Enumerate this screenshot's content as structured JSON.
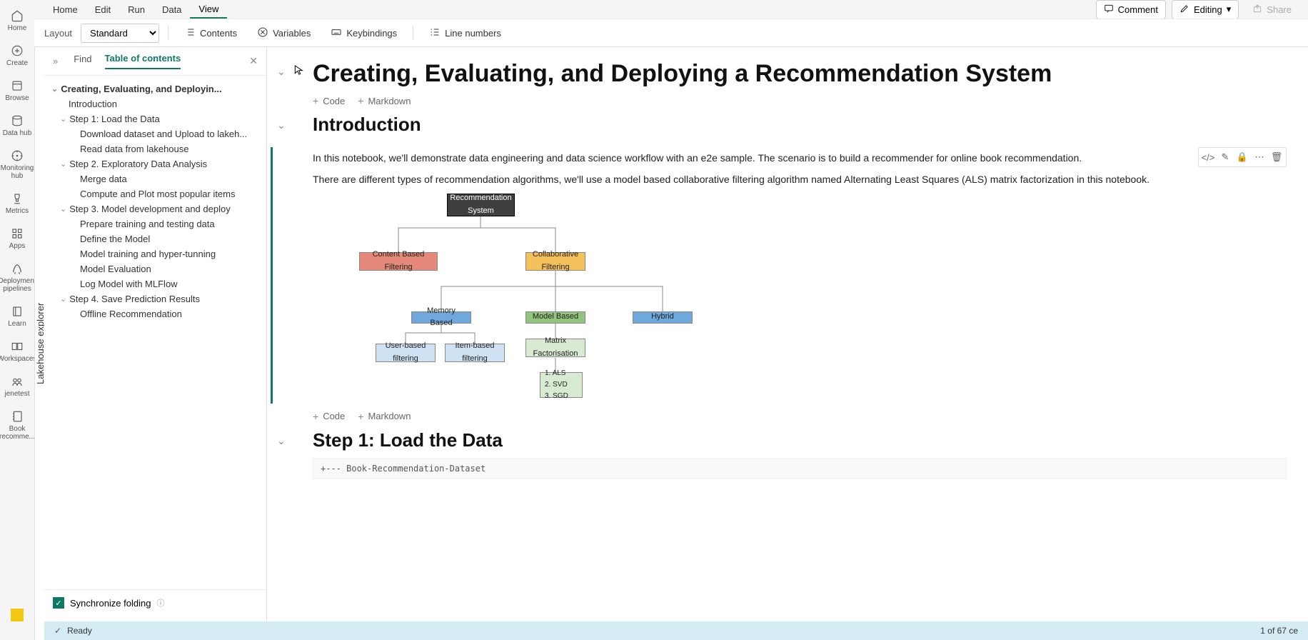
{
  "nav": [
    {
      "id": "home",
      "label": "Home"
    },
    {
      "id": "create",
      "label": "Create"
    },
    {
      "id": "browse",
      "label": "Browse"
    },
    {
      "id": "datahub",
      "label": "Data hub"
    },
    {
      "id": "monitoring",
      "label": "Monitoring hub"
    },
    {
      "id": "metrics",
      "label": "Metrics"
    },
    {
      "id": "apps",
      "label": "Apps"
    },
    {
      "id": "pipelines",
      "label": "Deployment pipelines"
    },
    {
      "id": "learn",
      "label": "Learn"
    },
    {
      "id": "workspaces",
      "label": "Workspaces"
    },
    {
      "id": "jenetest",
      "label": "jenetest"
    },
    {
      "id": "bookrec",
      "label": "Book recomme..."
    }
  ],
  "menu": {
    "items": [
      "Home",
      "Edit",
      "Run",
      "Data",
      "View"
    ],
    "active": "View"
  },
  "topActions": {
    "comment": "Comment",
    "editing": "Editing",
    "share": "Share"
  },
  "toolbar": {
    "layoutLabel": "Layout",
    "layoutValue": "Standard",
    "contents": "Contents",
    "variables": "Variables",
    "keybindings": "Keybindings",
    "linenumbers": "Line numbers"
  },
  "lakehouseTab": "Lakehouse explorer",
  "sidePanel": {
    "tabs": {
      "find": "Find",
      "toc": "Table of contents"
    },
    "toc": [
      {
        "label": "Creating, Evaluating, and Deployin...",
        "depth": 0,
        "root": true,
        "chev": true
      },
      {
        "label": "Introduction",
        "depth": 1
      },
      {
        "label": "Step 1: Load the Data",
        "depth": 1,
        "chev": true
      },
      {
        "label": "Download dataset and Upload to lakeh...",
        "depth": 2
      },
      {
        "label": "Read data from lakehouse",
        "depth": 2
      },
      {
        "label": "Step 2. Exploratory Data Analysis",
        "depth": 1,
        "chev": true
      },
      {
        "label": "Merge data",
        "depth": 2
      },
      {
        "label": "Compute and Plot most popular items",
        "depth": 2
      },
      {
        "label": "Step 3. Model development and deploy",
        "depth": 1,
        "chev": true
      },
      {
        "label": "Prepare training and testing data",
        "depth": 2
      },
      {
        "label": "Define the Model",
        "depth": 2
      },
      {
        "label": "Model training and hyper-tunning",
        "depth": 2
      },
      {
        "label": "Model Evaluation",
        "depth": 2
      },
      {
        "label": "Log Model with MLFlow",
        "depth": 2
      },
      {
        "label": "Step 4. Save Prediction Results",
        "depth": 1,
        "chev": true
      },
      {
        "label": "Offline Recommendation",
        "depth": 2
      }
    ],
    "sync": "Synchronize folding"
  },
  "status": {
    "ready": "Ready",
    "counter": "1 of 67 ce"
  },
  "addBtns": {
    "code": "Code",
    "markdown": "Markdown"
  },
  "notebook": {
    "title": "Creating, Evaluating, and Deploying a Recommendation System",
    "introHeading": "Introduction",
    "introP1": "In this notebook, we'll demonstrate data engineering and data science workflow with an e2e sample. The scenario is to build a recommender for online book recommendation.",
    "introP2": "There are different types of recommendation algorithms, we'll use a model based collaborative filtering algorithm named Alternating Least Squares (ALS) matrix factorization in this notebook.",
    "step1": "Step 1: Load the Data",
    "codeLine": "+--- Book-Recommendation-Dataset"
  },
  "diagram": {
    "root": "Recommendation System",
    "content": "Content Based Filtering",
    "collab": "Collaborative Filtering",
    "memory": "Memory Based",
    "model": "Model Based",
    "hybrid": "Hybrid",
    "user": "User-based filtering",
    "item": "Item-based filtering",
    "matrix": "Matrix Factorisation",
    "alg1": "1. ALS",
    "alg2": "2. SVD",
    "alg3": "3. SGD"
  }
}
